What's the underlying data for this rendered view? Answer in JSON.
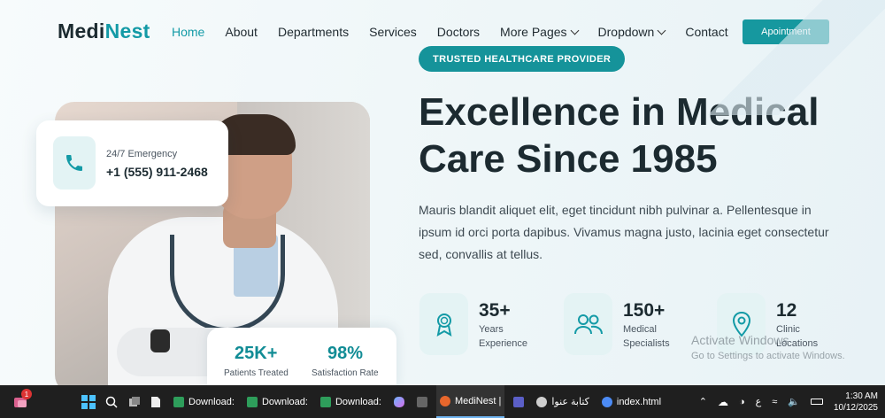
{
  "nav": {
    "logo_part1": "Medi",
    "logo_part2": "Nest",
    "items": [
      {
        "label": "Home",
        "active": true
      },
      {
        "label": "About"
      },
      {
        "label": "Departments"
      },
      {
        "label": "Services"
      },
      {
        "label": "Doctors"
      },
      {
        "label": "More Pages",
        "dropdown": true
      },
      {
        "label": "Dropdown",
        "dropdown": true
      },
      {
        "label": "Contact"
      }
    ],
    "cta": "Apointment"
  },
  "hero": {
    "badge": "TRUSTED HEALTHCARE PROVIDER",
    "title": "Excellence in Medical Care Since 1985",
    "lead": "Mauris blandit aliquet elit, eget tincidunt nibh pulvinar a. Pellentesque in ipsum id orci porta dapibus. Vivamus magna justo, lacinia eget consectetur sed, convallis at tellus.",
    "emergency": {
      "label": "24/7 Emergency",
      "phone": "+1 (555) 911-2468",
      "icon": "phone-icon"
    },
    "stats_card": [
      {
        "value": "25K+",
        "label": "Patients Treated"
      },
      {
        "value": "98%",
        "label": "Satisfaction Rate"
      }
    ],
    "features": [
      {
        "value": "35+",
        "label": "Years\nExperience",
        "icon": "award-icon"
      },
      {
        "value": "150+",
        "label": "Medical\nSpecialists",
        "icon": "users-icon"
      },
      {
        "value": "12",
        "label": "Clinic\nLocations",
        "icon": "location-pin-icon"
      }
    ]
  },
  "watermark": {
    "line1": "Activate Windows",
    "line2": "Go to Settings to activate Windows."
  },
  "taskbar": {
    "notification_count": "1",
    "apps": [
      {
        "label": "Download:",
        "color": "#2e9e5b"
      },
      {
        "label": "Download:",
        "color": "#2e9e5b"
      },
      {
        "label": "Download:",
        "color": "#2e9e5b"
      },
      {
        "label": "MediNest |",
        "color": "#e8672c",
        "active": true
      },
      {
        "label": "كتابة عنوا",
        "color": "#cfcfcf"
      },
      {
        "label": "index.html",
        "color": "#4c8bf5"
      }
    ],
    "lang": "ع",
    "time": "1:30 AM",
    "date": "10/12/2025"
  }
}
